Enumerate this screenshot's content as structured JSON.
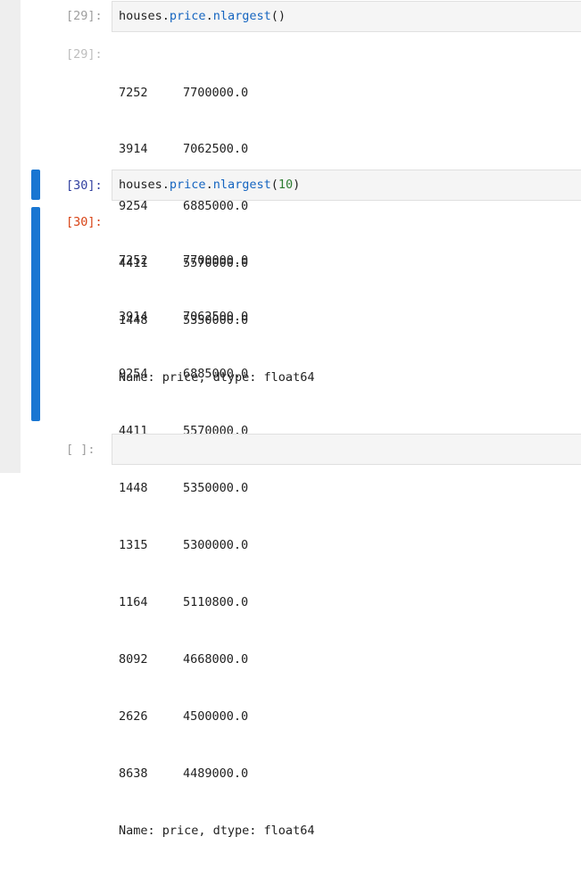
{
  "cells": [
    {
      "in_prompt": "[29]:",
      "code": {
        "obj": "houses",
        "dot1": ".",
        "attr1": "price",
        "dot2": ".",
        "method": "nlargest",
        "open": "(",
        "arg": "",
        "close": ")"
      },
      "out_prompt": "[29]:",
      "output_rows": [
        {
          "index": "7252",
          "value": "7700000.0"
        },
        {
          "index": "3914",
          "value": "7062500.0"
        },
        {
          "index": "9254",
          "value": "6885000.0"
        },
        {
          "index": "4411",
          "value": "5570000.0"
        },
        {
          "index": "1448",
          "value": "5350000.0"
        }
      ],
      "footer": "Name: price, dtype: float64"
    },
    {
      "in_prompt": "[30]:",
      "code": {
        "obj": "houses",
        "dot1": ".",
        "attr1": "price",
        "dot2": ".",
        "method": "nlargest",
        "open": "(",
        "arg": "10",
        "close": ")"
      },
      "out_prompt": "[30]:",
      "output_rows": [
        {
          "index": "7252",
          "value": "7700000.0"
        },
        {
          "index": "3914",
          "value": "7062500.0"
        },
        {
          "index": "9254",
          "value": "6885000.0"
        },
        {
          "index": "4411",
          "value": "5570000.0"
        },
        {
          "index": "1448",
          "value": "5350000.0"
        },
        {
          "index": "1315",
          "value": "5300000.0"
        },
        {
          "index": "1164",
          "value": "5110800.0"
        },
        {
          "index": "8092",
          "value": "4668000.0"
        },
        {
          "index": "2626",
          "value": "4500000.0"
        },
        {
          "index": "8638",
          "value": "4489000.0"
        }
      ],
      "footer": "Name: price, dtype: float64"
    },
    {
      "in_prompt": "[ ]:"
    }
  ],
  "colors": {
    "active_bar": "#1976d2",
    "input_bg": "#f5f5f5",
    "active_out_prompt": "#d84315",
    "attr_color": "#1565c0",
    "number_color": "#2e7d32"
  }
}
